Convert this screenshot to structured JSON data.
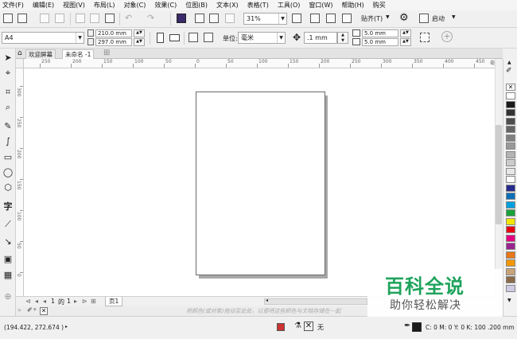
{
  "menu": [
    "文件(F)",
    "编辑(E)",
    "视图(V)",
    "布局(L)",
    "对象(C)",
    "效果(C)",
    "位图(B)",
    "文本(X)",
    "表格(T)",
    "工具(O)",
    "窗口(W)",
    "帮助(H)",
    "购买"
  ],
  "toolbar": {
    "zoom": "31%",
    "snap_label": "贴齐(T)",
    "launch_label": "启动"
  },
  "props": {
    "page_size": "A4",
    "width": "210.0 mm",
    "height": "297.0 mm",
    "units_label": "单位:",
    "units": "毫米",
    "nudge": ".1 mm",
    "dup_x": "5.0 mm",
    "dup_y": "5.0 mm"
  },
  "tabs": {
    "welcome": "欢迎屏幕",
    "doc": "未命名 -1"
  },
  "rulers": {
    "h_ticks": [
      "250",
      "200",
      "150",
      "100",
      "50",
      "0",
      "50",
      "100",
      "150",
      "200",
      "250",
      "300",
      "350",
      "400",
      "450"
    ],
    "h_unit": "毫米",
    "v_ticks": [
      "300",
      "250",
      "200",
      "150",
      "100",
      "50",
      "0"
    ]
  },
  "pager": {
    "current": "1",
    "of": "的",
    "total": "1",
    "page_tab": "页1"
  },
  "hint": "将颜色(或对象)拖动至此处，以便将这些颜色与文档存储在一起",
  "status": {
    "coords": "(194.422, 272.674 )",
    "fill_none": "无",
    "outline": "C: 0 M: 0 Y: 0 K: 100  .200 mm"
  },
  "palette": [
    "#ffffff",
    "#1a1a1a",
    "#333333",
    "#4d4d4d",
    "#666666",
    "#808080",
    "#999999",
    "#b3b3b3",
    "#cccccc",
    "#e6e6e6",
    "#ffffff",
    "#262a8c",
    "#0b6fb8",
    "#00a0e0",
    "#1aa23a",
    "#f2e500",
    "#e60012",
    "#e4007f",
    "#9a258f",
    "#e77817",
    "#f39800",
    "#c8a37a",
    "#8b6a4a",
    "#cfcbe3"
  ],
  "watermark": {
    "title": "百科全说",
    "subtitle": "助你轻松解决"
  }
}
